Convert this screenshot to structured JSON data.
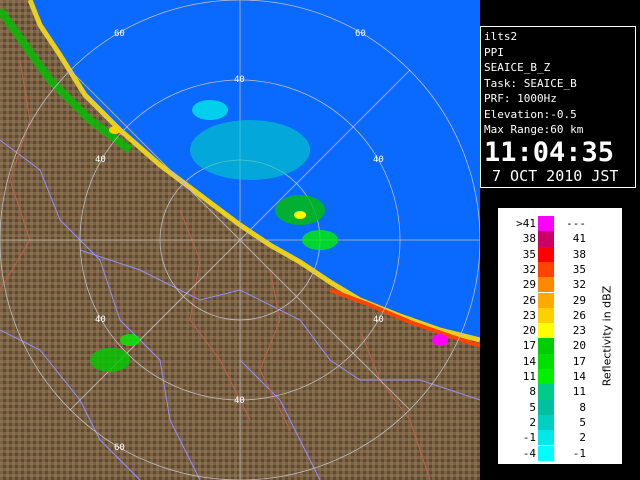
{
  "info": {
    "lines": [
      "ilts2",
      "PPI",
      "SEAICE_B_Z",
      "Task: SEAICE_B",
      "PRF: 1000Hz",
      "Elevation:-0.5",
      "Max Range:60 km"
    ],
    "time": "11:04:35",
    "date": "7 OCT 2010 JST"
  },
  "legend": {
    "unit": "Reflectivity in dBZ",
    "rows": [
      {
        "lo": ">41",
        "hi": "---",
        "color": "#ff00ff"
      },
      {
        "lo": "38",
        "hi": "41",
        "color": "#cc0066"
      },
      {
        "lo": "35",
        "hi": "38",
        "color": "#ff0000"
      },
      {
        "lo": "32",
        "hi": "35",
        "color": "#ff4400"
      },
      {
        "lo": "29",
        "hi": "32",
        "color": "#ff8800"
      },
      {
        "lo": "26",
        "hi": "29",
        "color": "#ffaa00"
      },
      {
        "lo": "23",
        "hi": "26",
        "color": "#ffd000"
      },
      {
        "lo": "20",
        "hi": "23",
        "color": "#ffff00"
      },
      {
        "lo": "17",
        "hi": "20",
        "color": "#00cc00"
      },
      {
        "lo": "14",
        "hi": "17",
        "color": "#00e000"
      },
      {
        "lo": "11",
        "hi": "14",
        "color": "#00f000"
      },
      {
        "lo": "8",
        "hi": "11",
        "color": "#00cc88"
      },
      {
        "lo": "5",
        "hi": "8",
        "color": "#00c0a0"
      },
      {
        "lo": "2",
        "hi": "5",
        "color": "#00d0c0"
      },
      {
        "lo": "-1",
        "hi": "2",
        "color": "#00e8e8"
      },
      {
        "lo": "-4",
        "hi": "-1",
        "color": "#00ffff"
      }
    ]
  },
  "range_labels": {
    "ring_40": "40",
    "ring_60": "60"
  },
  "colors": {
    "sea": "#0a6aff",
    "land": "#7a6244",
    "coast": "#e8d020",
    "border": "#9090ff",
    "river": "#c06050"
  }
}
